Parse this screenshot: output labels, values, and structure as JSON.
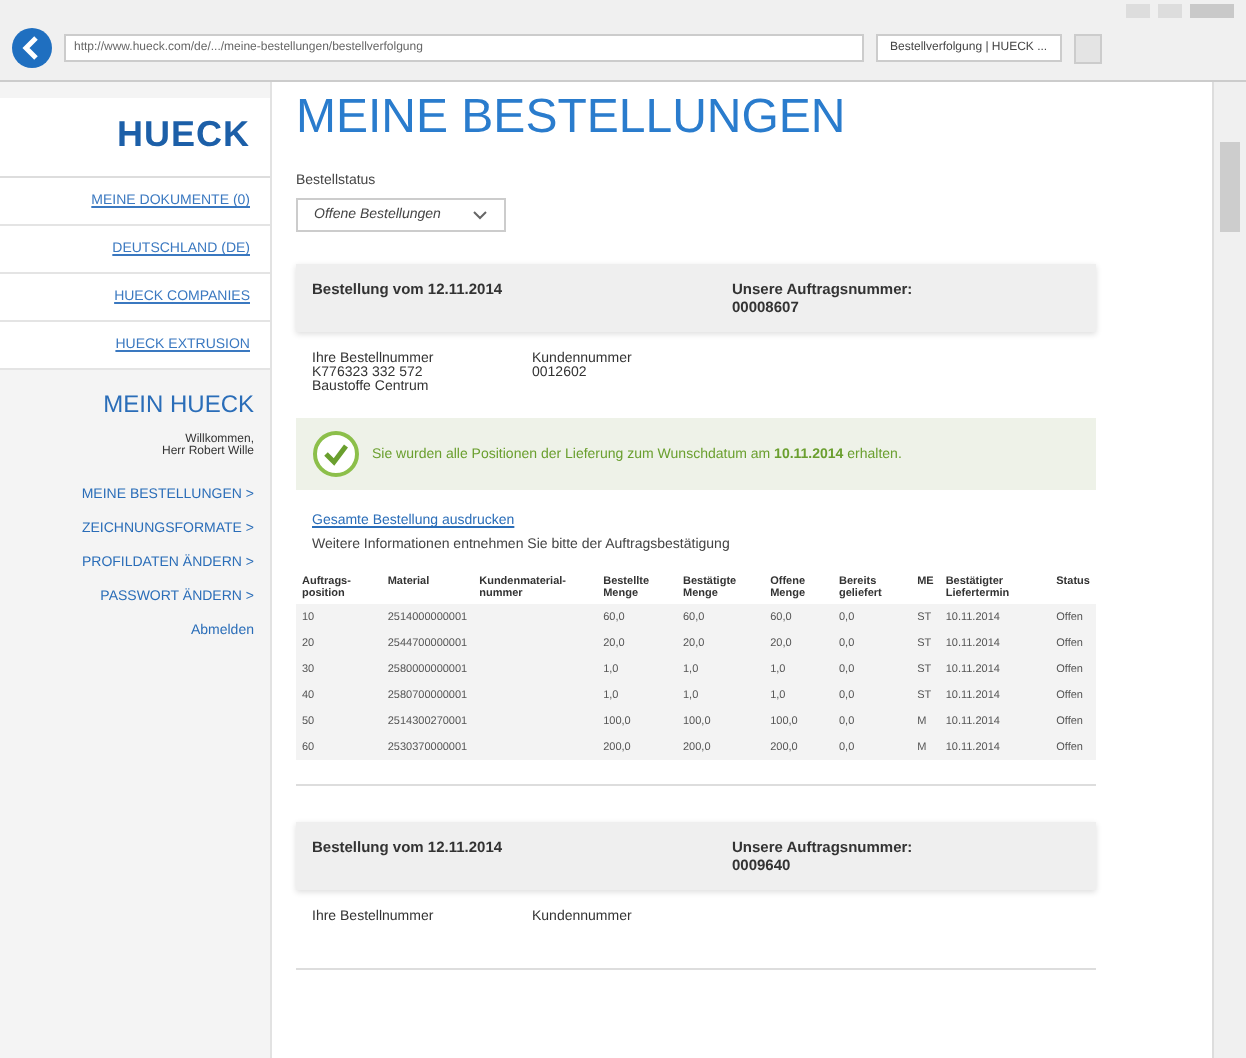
{
  "browser": {
    "address": "http://www.hueck.com/de/.../meine-bestellungen/bestellverfolgung",
    "tab": "Bestellverfolgung | HUECK ..."
  },
  "sidebar": {
    "logo": "HUECK",
    "items": [
      {
        "label": "MEINE DOKUMENTE (0)"
      },
      {
        "label": "DEUTSCHLAND (DE)"
      },
      {
        "label": "HUECK COMPANIES"
      },
      {
        "label": "HUECK EXTRUSION"
      }
    ],
    "account": {
      "title": "MEIN HUECK",
      "welcome": [
        "Willkommen,",
        "Herr Robert Wille"
      ],
      "links": [
        "MEINE BESTELLUNGEN >",
        "ZEICHNUNGSFORMATE >",
        "PROFILDATEN ÄNDERN >",
        "PASSWORT ÄNDERN >"
      ],
      "logout": "Abmelden"
    }
  },
  "main": {
    "title": "MEINE BESTELLUNGEN",
    "filter": {
      "label": "Bestellstatus",
      "value": "Offene Bestellungen"
    },
    "orders": [
      {
        "heading": "Bestellung vom 12.11.2014",
        "order_label": "Unsere Auftragsnummer:",
        "order_number": "00008607",
        "ref_label": "Ihre Bestellnummer",
        "ref_lines": [
          "K776323 332 572",
          "Baustoffe Centrum"
        ],
        "customer_label": "Kundennummer",
        "customer_number": "0012602",
        "notice": "Sie wurden alle Positionen der Lieferung zum Wunschdatum am **10.11.2014** erhalten.",
        "print_link": "Gesamte Bestellung ausdrucken",
        "info": "Weitere Informationen entnehmen Sie bitte der Auftragsbestätigung",
        "table": {
          "columns": [
            "Auftrags-position",
            "Material",
            "Kundenmaterial-nummer",
            "Bestellte Menge",
            "Bestätigte Menge",
            "Offene Menge",
            "Bereits geliefert",
            "ME",
            "Bestätigter Liefertermin",
            "Status"
          ],
          "rows": [
            [
              "10",
              "2514000000001",
              "",
              "60,0",
              "60,0",
              "60,0",
              "0,0",
              "ST",
              "10.11.2014",
              "Offen"
            ],
            [
              "20",
              "2544700000001",
              "",
              "20,0",
              "20,0",
              "20,0",
              "0,0",
              "ST",
              "10.11.2014",
              "Offen"
            ],
            [
              "30",
              "2580000000001",
              "",
              "1,0",
              "1,0",
              "1,0",
              "0,0",
              "ST",
              "10.11.2014",
              "Offen"
            ],
            [
              "40",
              "2580700000001",
              "",
              "1,0",
              "1,0",
              "1,0",
              "0,0",
              "ST",
              "10.11.2014",
              "Offen"
            ],
            [
              "50",
              "2514300270001",
              "",
              "100,0",
              "100,0",
              "100,0",
              "0,0",
              "M",
              "10.11.2014",
              "Offen"
            ],
            [
              "60",
              "2530370000001",
              "",
              "200,0",
              "200,0",
              "200,0",
              "0,0",
              "M",
              "10.11.2014",
              "Offen"
            ]
          ]
        }
      },
      {
        "heading": "Bestellung vom 12.11.2014",
        "order_label": "Unsere Auftragsnummer:",
        "order_number": "0009640",
        "ref_label": "Ihre Bestellnummer",
        "customer_label": "Kundennummer"
      }
    ]
  }
}
